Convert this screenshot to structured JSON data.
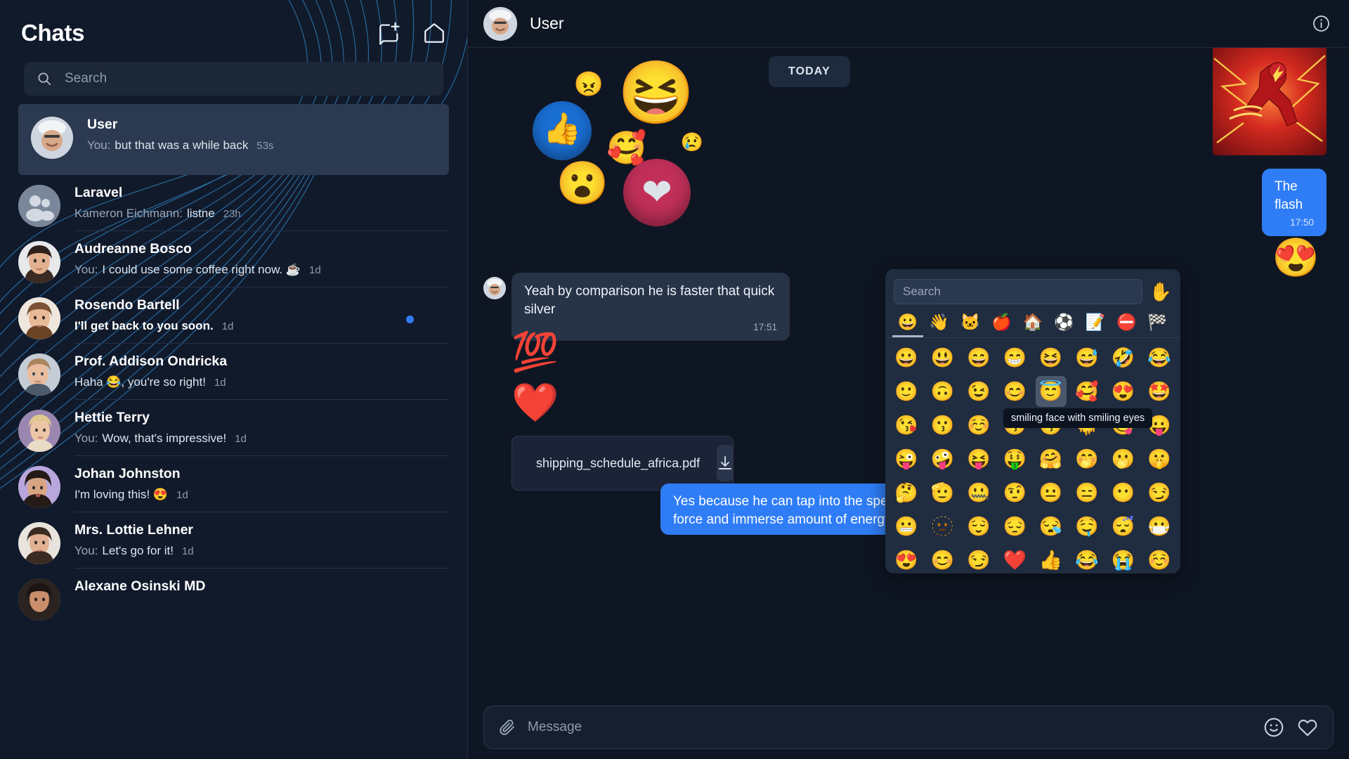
{
  "sidebar": {
    "title": "Chats",
    "header_icons": [
      {
        "name": "new-chat-icon",
        "label": "New chat"
      },
      {
        "name": "home-icon",
        "label": "Home"
      }
    ],
    "search": {
      "placeholder": "Search",
      "value": "",
      "icon": "search-icon"
    },
    "chats": [
      {
        "name": "User",
        "prefix": "You:",
        "message": "but that was a while back",
        "time": "53s",
        "active": true,
        "unread": false,
        "avatar": "man-cap",
        "dot": false
      },
      {
        "name": "Laravel",
        "prefix": "Kameron Eichmann:",
        "message": "listne",
        "time": "23h",
        "active": false,
        "unread": false,
        "avatar": "group",
        "dot": false
      },
      {
        "name": "Audreanne Bosco",
        "prefix": "You:",
        "message": "I could use some coffee right now. ☕",
        "time": "1d",
        "active": false,
        "unread": false,
        "avatar": "woman-dark-hair",
        "dot": false
      },
      {
        "name": "Rosendo Bartell",
        "prefix": "",
        "message": "I'll get back to you soon.",
        "time": "1d",
        "active": false,
        "unread": true,
        "avatar": "woman-brown-hair",
        "dot": true
      },
      {
        "name": "Prof. Addison Ondricka",
        "prefix": "",
        "message": "Haha 😂, you're so right!",
        "time": "1d",
        "active": false,
        "unread": false,
        "avatar": "man-blond",
        "dot": false
      },
      {
        "name": "Hettie Terry",
        "prefix": "You:",
        "message": "Wow, that's impressive!",
        "time": "1d",
        "active": false,
        "unread": false,
        "avatar": "woman-blonde",
        "dot": false
      },
      {
        "name": "Johan Johnston",
        "prefix": "",
        "message": "I'm loving this! 😍",
        "time": "1d",
        "active": false,
        "unread": false,
        "avatar": "woman-purple",
        "dot": false
      },
      {
        "name": "Mrs. Lottie Lehner",
        "prefix": "You:",
        "message": "Let's go for it!",
        "time": "1d",
        "active": false,
        "unread": false,
        "avatar": "woman-dark-hair2",
        "dot": false
      },
      {
        "name": "Alexane Osinski MD",
        "prefix": "",
        "message": "",
        "time": "",
        "active": false,
        "unread": false,
        "avatar": "woman-dark-hair3",
        "dot": false
      }
    ]
  },
  "conversation": {
    "header": {
      "name": "User",
      "avatar": "man-cap",
      "info_icon": "info-icon"
    },
    "date_divider": "TODAY",
    "messages": [
      {
        "type": "image",
        "alt": "The Flash comic art",
        "side": "out"
      },
      {
        "type": "text",
        "side": "out",
        "text": "The flash",
        "time": "17:50"
      },
      {
        "type": "sticker",
        "side": "out",
        "emoji": "😍"
      },
      {
        "type": "text",
        "side": "in",
        "text": "Yeah by comparison he is faster that quick silver",
        "time": "17:51"
      },
      {
        "type": "sticker",
        "side": "in",
        "emoji": "💯"
      },
      {
        "type": "sticker",
        "side": "in",
        "emoji": "❤️"
      },
      {
        "type": "file",
        "side": "in",
        "filename": "shipping_schedule_africa.pdf",
        "action": "download"
      },
      {
        "type": "text",
        "side": "out",
        "text": "Yes because he can tap into the speed force and immerse amount of energy",
        "time": ""
      }
    ],
    "reactions_overlay": [
      "😠",
      "😆",
      "👍",
      "🥰",
      "😢",
      "😮",
      "🤍"
    ]
  },
  "composer": {
    "attach_icon": "paperclip-icon",
    "placeholder": "Message",
    "value": "",
    "emoji_icon": "smiley-icon",
    "like_icon": "heart-icon"
  },
  "emoji_picker": {
    "search_placeholder": "Search",
    "search_value": "",
    "skin_tone_icon": "✋",
    "categories": [
      {
        "icon": "😀",
        "name": "smileys",
        "active": true
      },
      {
        "icon": "👋",
        "name": "people",
        "active": false
      },
      {
        "icon": "🐱",
        "name": "animals",
        "active": false
      },
      {
        "icon": "🍎",
        "name": "food",
        "active": false
      },
      {
        "icon": "🏠",
        "name": "travel",
        "active": false
      },
      {
        "icon": "⚽",
        "name": "activities",
        "active": false
      },
      {
        "icon": "📝",
        "name": "objects",
        "active": false
      },
      {
        "icon": "⛔",
        "name": "symbols",
        "active": false
      },
      {
        "icon": "🏁",
        "name": "flags",
        "active": false
      }
    ],
    "tooltip": "smiling face with smiling eyes",
    "hovered_index": {
      "row": 1,
      "col": 4
    },
    "grid": [
      [
        "😀",
        "😃",
        "😄",
        "😁",
        "😆",
        "😅",
        "🤣",
        "😂"
      ],
      [
        "🙂",
        "🙃",
        "😉",
        "😊",
        "😇",
        "🥰",
        "😍",
        "🤩"
      ],
      [
        "😘",
        "😗",
        "☺️",
        "😚",
        "😙",
        "🫠",
        "😋",
        "😛"
      ],
      [
        "😜",
        "🤪",
        "😝",
        "🤑",
        "🤗",
        "🤭",
        "🫢",
        "🤫"
      ],
      [
        "🤔",
        "🫡",
        "🤐",
        "🤨",
        "😐",
        "😑",
        "😶",
        "😏"
      ],
      [
        "😬",
        "🫥",
        "😌",
        "😔",
        "😪",
        "🤤",
        "😴",
        "😷"
      ],
      [
        "😍",
        "😊",
        "😏",
        "❤️",
        "👍",
        "😂",
        "😭",
        "☺️"
      ]
    ]
  },
  "colors": {
    "accent": "#2f7df6",
    "sidebar_bg": "#111a2b",
    "main_bg": "#0f1623",
    "bubble_in": "#273347",
    "picker_bg": "#202c3f",
    "deco_line": "#2f7db8"
  }
}
